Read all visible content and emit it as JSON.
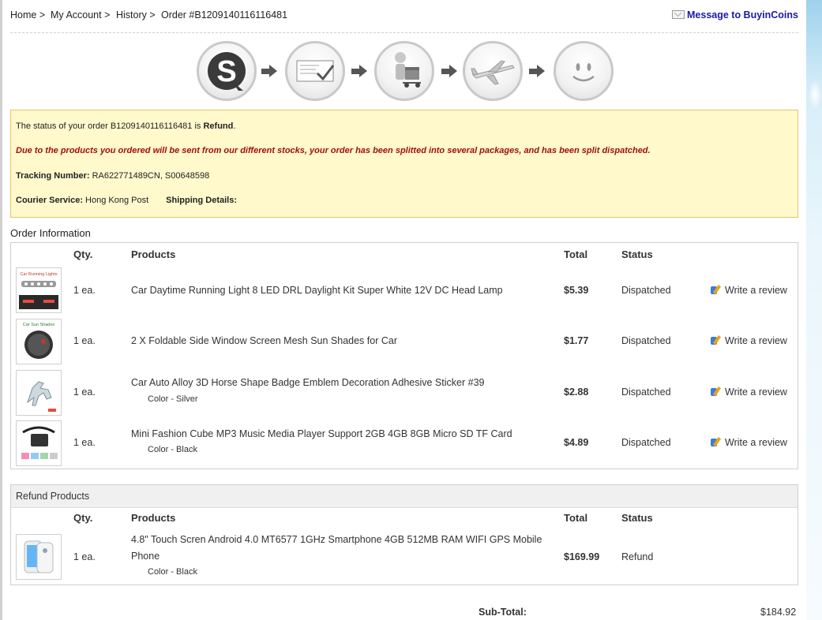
{
  "breadcrumb": {
    "home": "Home >",
    "account": "My Account >",
    "history": "History >",
    "order": "Order #B1209140116116481"
  },
  "message_link": "Message to BuyinCoins",
  "progress_icons": [
    "logo-icon",
    "order-form-icon",
    "delivery-man-icon",
    "airplane-icon",
    "smiley-icon"
  ],
  "notice": {
    "status_prefix": "The status of your order B1209140116116481 is",
    "status_value": "Refund",
    "status_suffix": ".",
    "split_message": "Due to the products you ordered will be sent from our different stocks, your order has been splitted into several packages, and has been split dispatched.",
    "tracking_label": "Tracking Number:",
    "tracking_value": "RA622771489CN, S00648598",
    "courier_label": "Courier Service:",
    "courier_value": "Hong Kong Post",
    "shipping_label": "Shipping Details:"
  },
  "order_info": {
    "title": "Order Information",
    "headers": {
      "qty": "Qty.",
      "products": "Products",
      "total": "Total",
      "status": "Status"
    },
    "rows": [
      {
        "qty": "1 ea.",
        "product": "Car Daytime Running Light 8 LED DRL Daylight Kit Super White 12V DC Head Lamp",
        "option": "",
        "total": "$5.39",
        "status": "Dispatched",
        "action": "Write a review",
        "thumb_caption": "Car Running Lights"
      },
      {
        "qty": "1 ea.",
        "product": "2 X Foldable Side Window Screen Mesh Sun Shades for Car",
        "option": "",
        "total": "$1.77",
        "status": "Dispatched",
        "action": "Write a review",
        "thumb_caption": "Car Sun Shades"
      },
      {
        "qty": "1 ea.",
        "product": "Car Auto Alloy 3D Horse Shape Badge Emblem Decoration Adhesive Sticker #39",
        "option": "Color - Silver",
        "total": "$2.88",
        "status": "Dispatched",
        "action": "Write a review",
        "thumb_caption": ""
      },
      {
        "qty": "1 ea.",
        "product": "Mini Fashion Cube MP3 Music Media Player Support 2GB 4GB 8GB Micro SD TF Card",
        "option": "Color - Black",
        "total": "$4.89",
        "status": "Dispatched",
        "action": "Write a review",
        "thumb_caption": ""
      }
    ]
  },
  "refund": {
    "title": "Refund Products",
    "headers": {
      "qty": "Qty.",
      "products": "Products",
      "total": "Total",
      "status": "Status"
    },
    "row": {
      "qty": "1 ea.",
      "product_line1": "4.8\" Touch Scren Android 4.0 MT6577 1GHz Smartphone 4GB 512MB RAM WIFI GPS Mobile",
      "product_line2": "Phone",
      "option": "Color - Black",
      "total": "$169.99",
      "status": "Refund"
    }
  },
  "subtotal": {
    "label": "Sub-Total:",
    "value": "$184.92"
  },
  "colors": {
    "link": "#1a1aa6",
    "notice_bg": "#fff9cc",
    "notice_border": "#e3c46a",
    "warning_text": "#a10f0f"
  }
}
